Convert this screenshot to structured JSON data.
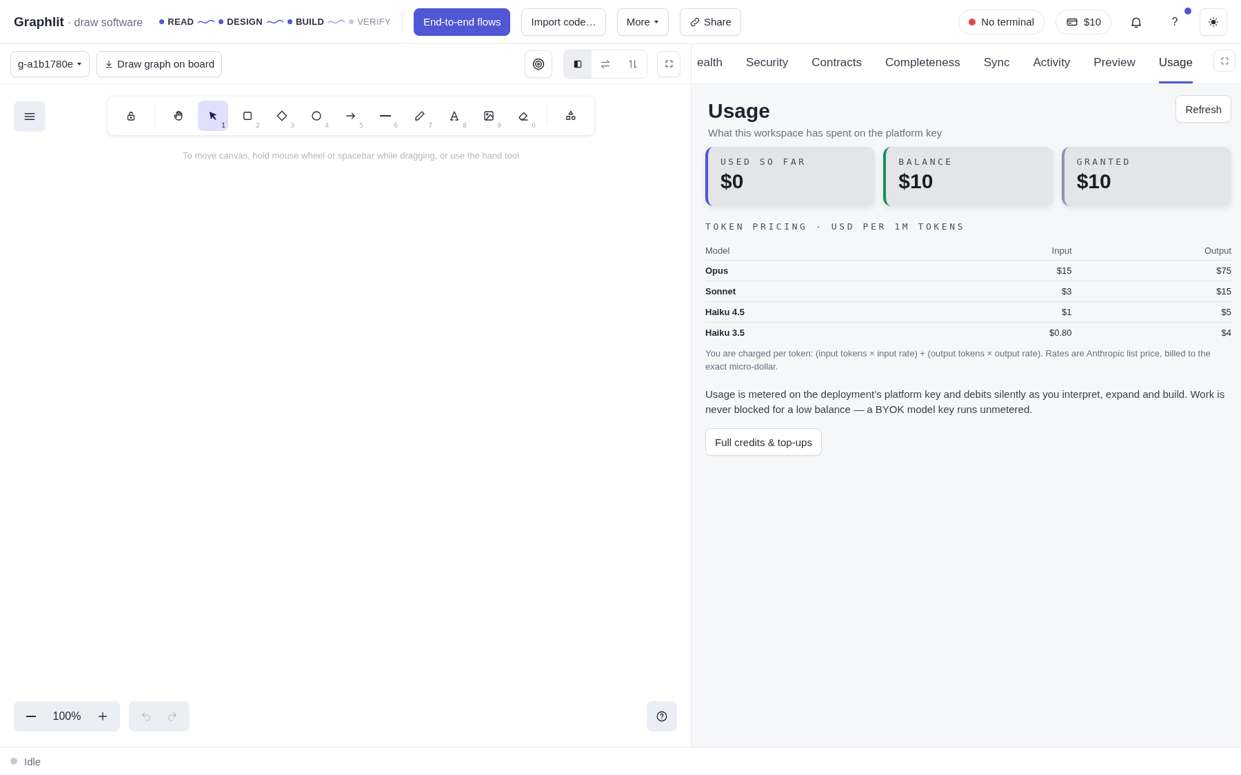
{
  "app": {
    "name": "Graphlit",
    "tagline": "· draw software"
  },
  "pipeline": [
    {
      "label": "READ",
      "done": true
    },
    {
      "label": "DESIGN",
      "done": true
    },
    {
      "label": "BUILD",
      "done": true
    },
    {
      "label": "VERIFY",
      "done": false
    }
  ],
  "header_buttons": [
    {
      "label": "End-to-end flows",
      "kind": "primary"
    },
    {
      "label": "Import code…",
      "kind": "plain"
    },
    {
      "label": "More",
      "kind": "menu"
    },
    {
      "label": "Share",
      "kind": "link"
    }
  ],
  "terminal": {
    "label": "No terminal",
    "color": "#e5484d"
  },
  "credits": {
    "label": "$10"
  },
  "help": {
    "label": "?",
    "notification": true
  },
  "graph_select": {
    "value": "g-a1b1780e"
  },
  "draw_button": {
    "label": "Draw graph on board"
  },
  "view_modes": [
    {
      "kind": "panel",
      "selected": true
    },
    {
      "kind": "swap",
      "selected": false
    },
    {
      "kind": "sort",
      "selected": false
    }
  ],
  "tools": [
    {
      "kind": "lock",
      "selected": false
    },
    {
      "kind": "hand",
      "selected": false
    },
    {
      "kind": "select",
      "key": "1",
      "selected": true
    },
    {
      "kind": "rectangle",
      "key": "2",
      "selected": false
    },
    {
      "kind": "diamond",
      "key": "3",
      "selected": false
    },
    {
      "kind": "ellipse",
      "key": "4",
      "selected": false
    },
    {
      "kind": "arrow",
      "key": "5",
      "selected": false
    },
    {
      "kind": "line",
      "key": "6",
      "selected": false
    },
    {
      "kind": "pencil",
      "key": "7",
      "selected": false
    },
    {
      "kind": "text",
      "key": "8",
      "selected": false
    },
    {
      "kind": "image",
      "key": "9",
      "selected": false
    },
    {
      "kind": "eraser",
      "key": "0",
      "selected": false
    },
    {
      "kind": "shapes",
      "selected": false
    }
  ],
  "canvas_hint": "To move canvas, hold mouse wheel or spacebar while dragging, or use the hand tool",
  "zoom": {
    "value": "100%"
  },
  "history": [
    {
      "kind": "undo",
      "disabled": true
    },
    {
      "kind": "redo",
      "disabled": true
    }
  ],
  "status": {
    "label": "Idle"
  },
  "tabs": [
    {
      "label": "ealth",
      "selected": false
    },
    {
      "label": "Security",
      "selected": false
    },
    {
      "label": "Contracts",
      "selected": false
    },
    {
      "label": "Completeness",
      "selected": false
    },
    {
      "label": "Sync",
      "selected": false
    },
    {
      "label": "Activity",
      "selected": false
    },
    {
      "label": "Preview",
      "selected": false
    },
    {
      "label": "Usage",
      "selected": true
    }
  ],
  "usage": {
    "title": "Usage",
    "subtitle": "What this workspace has spent on the platform key",
    "refresh": "Refresh",
    "cards": [
      {
        "label": "USED SO FAR",
        "value": "$0",
        "color": "#4f56d8"
      },
      {
        "label": "BALANCE",
        "value": "$10",
        "color": "#15905f"
      },
      {
        "label": "GRANTED",
        "value": "$10",
        "color": "#8e97ab"
      }
    ],
    "pricing_title": "TOKEN PRICING · USD PER 1M TOKENS",
    "table": {
      "columns": [
        "Model",
        "Input",
        "Output"
      ],
      "rows": [
        [
          "Opus",
          "$15",
          "$75"
        ],
        [
          "Sonnet",
          "$3",
          "$15"
        ],
        [
          "Haiku 4.5",
          "$1",
          "$5"
        ],
        [
          "Haiku 3.5",
          "$0.80",
          "$4"
        ]
      ]
    },
    "note": "You are charged per token: (input tokens × input rate) + (output tokens × output rate). Rates are Anthropic list price, billed to the exact micro-dollar.",
    "description": "Usage is metered on the deployment’s platform key and debits silently as you interpret, expand and build. Work is never blocked for a low balance — a BYOK model key runs unmetered.",
    "credits_button": "Full credits & top-ups"
  }
}
